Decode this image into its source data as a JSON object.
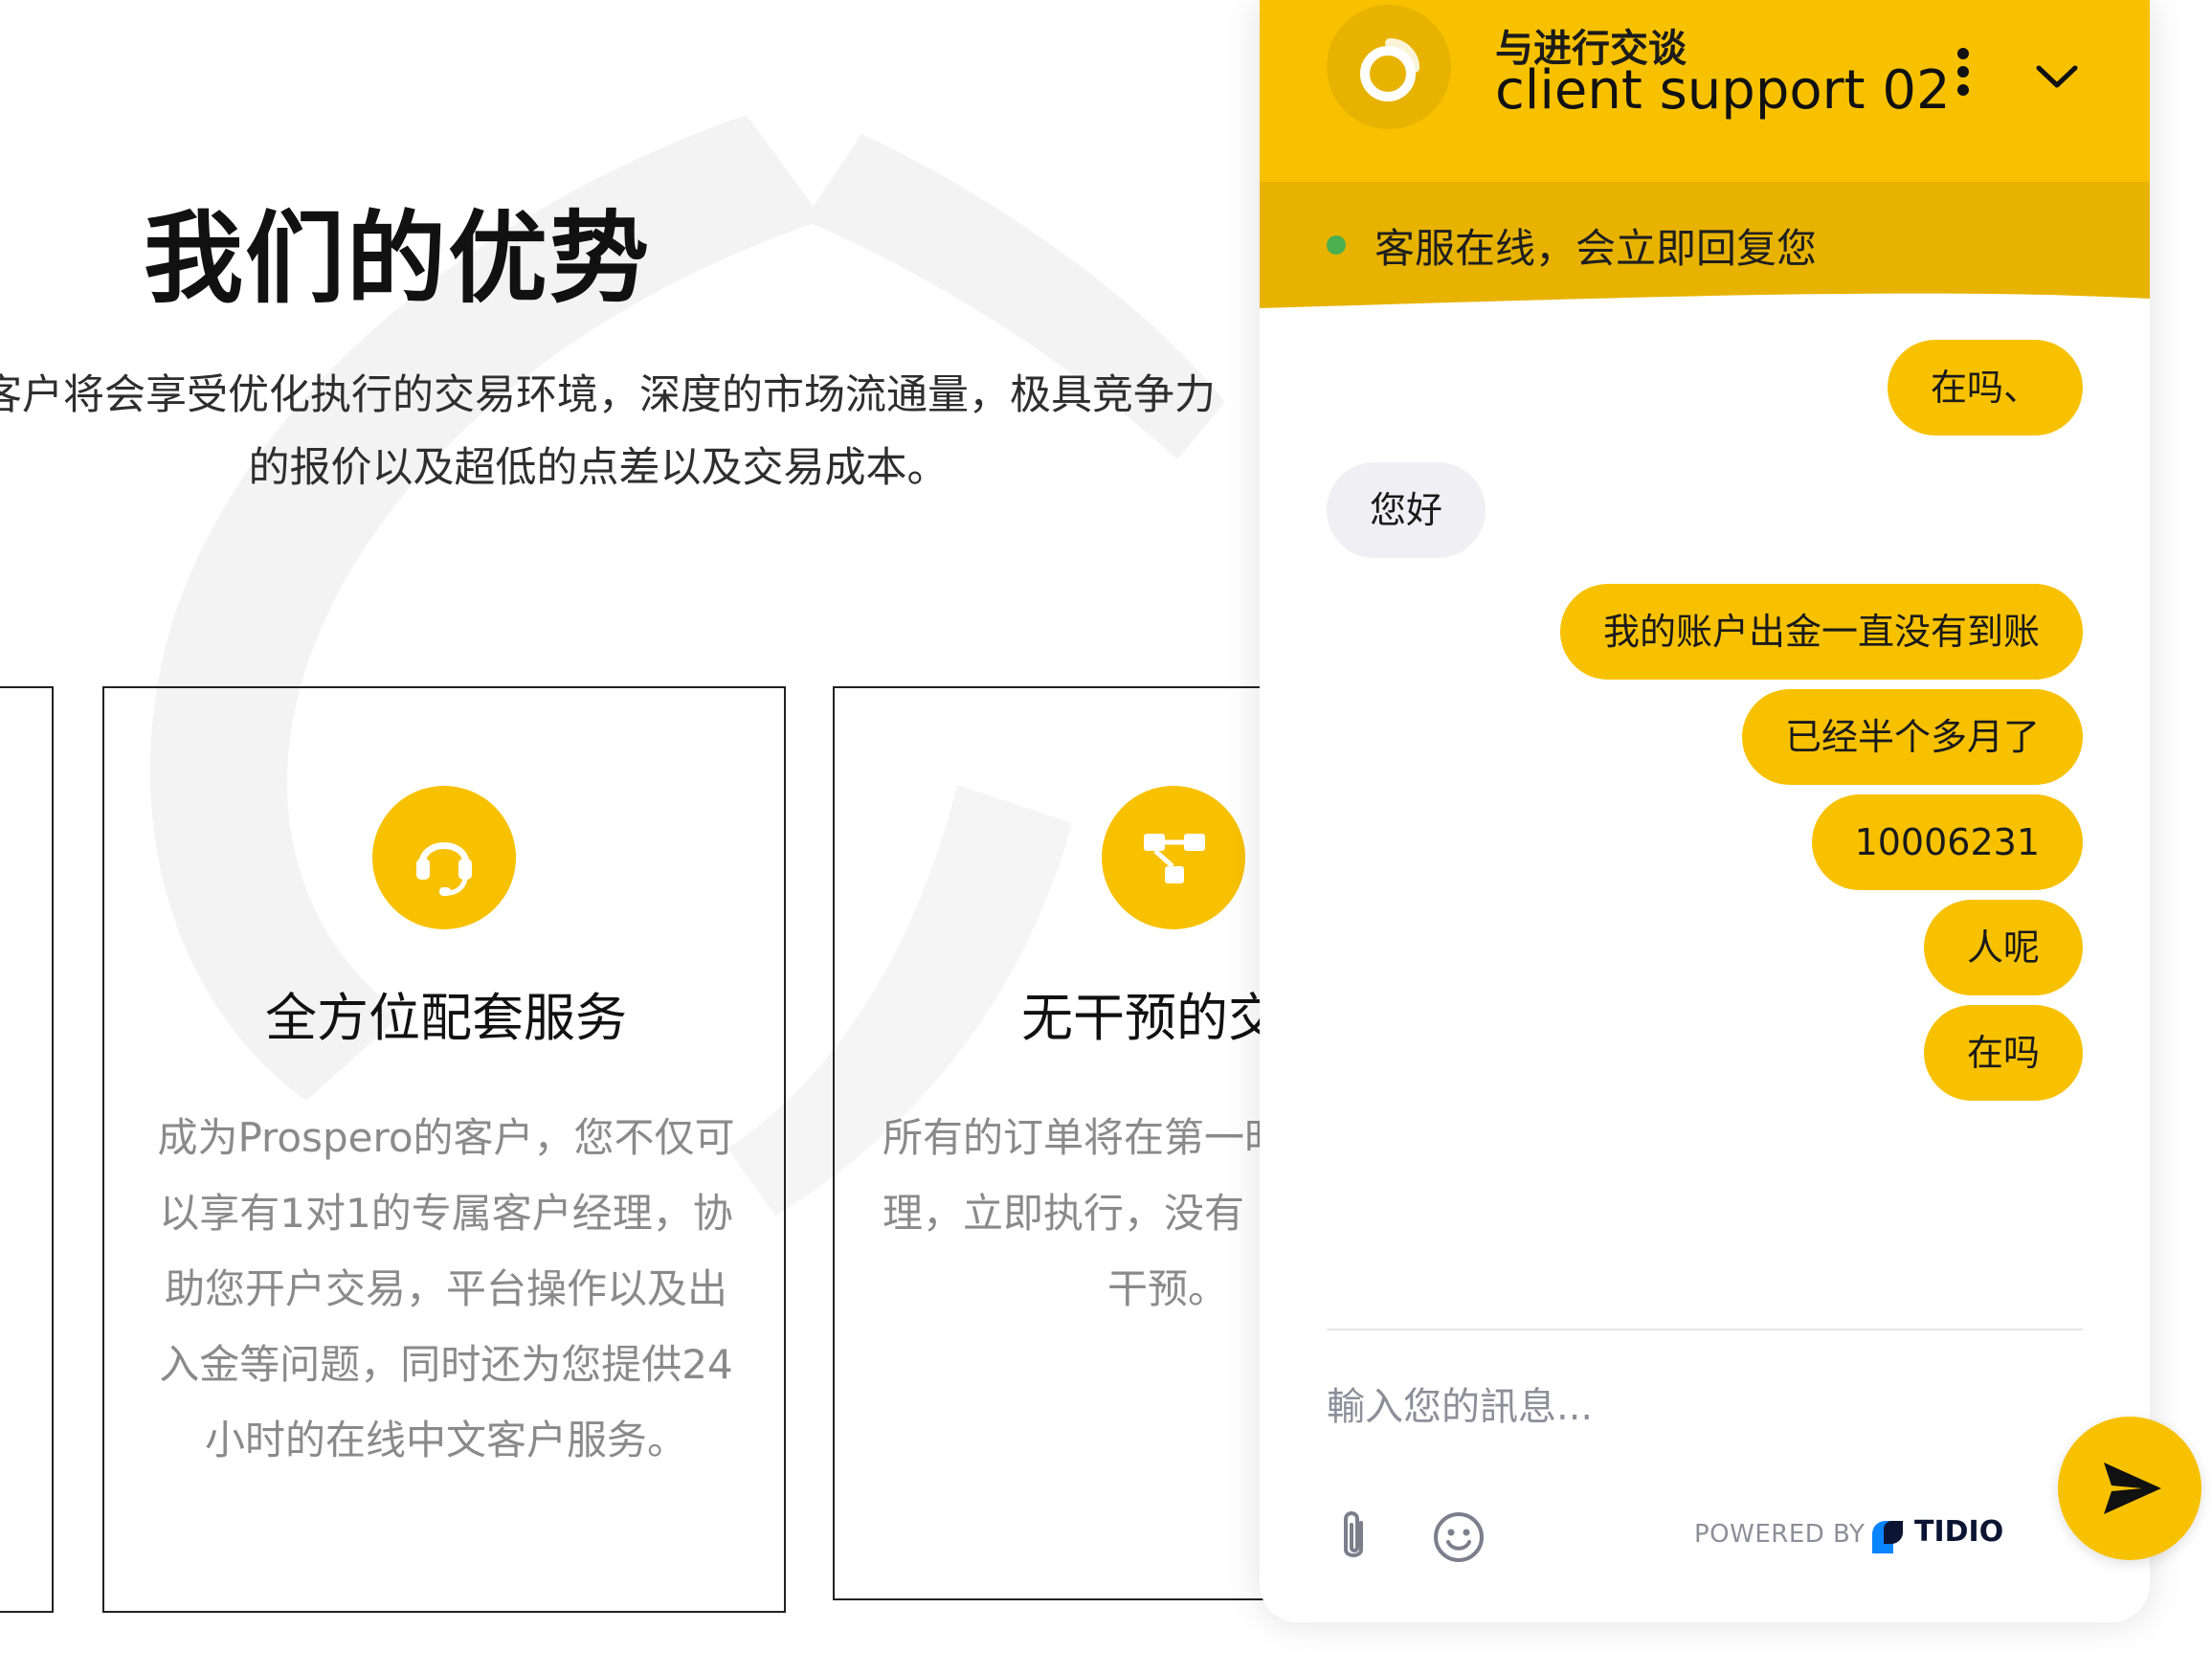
{
  "section": {
    "title": "我们的优势",
    "description_lines": [
      "客户将会享受优化执行的交易环境，深度的市场流通量，极具竞争力",
      "的报价以及超低的点差以及交易成本。"
    ]
  },
  "cards": [
    {
      "icon": "headset-icon",
      "title": "全方位配套服务",
      "text_lines": [
        "成为Prospero的客户，您不仅可",
        "以享有1对1的专属客户经理，协",
        "助您开户交易，平台操作以及出",
        "入金等问题，同时还为您提供24",
        "小时的在线中文客户服务。"
      ]
    },
    {
      "icon": "workflow-icon",
      "title": "无干预的交",
      "text_lines": [
        "所有的订单将在第一时",
        "理，立即执行，没有",
        "干预。"
      ]
    }
  ],
  "chat": {
    "header_subtitle": "与进行交谈",
    "header_title": "client support 02",
    "status_text": "客服在线，会立即回复您",
    "messages": [
      {
        "direction": "out",
        "text": "在吗、"
      },
      {
        "direction": "in",
        "text": "您好"
      },
      {
        "direction": "out",
        "text": "我的账户出金一直没有到账"
      },
      {
        "direction": "out",
        "text": "已经半个多月了"
      },
      {
        "direction": "out",
        "text": "10006231"
      },
      {
        "direction": "out",
        "text": "人呢"
      },
      {
        "direction": "out",
        "text": "在吗"
      }
    ],
    "input_placeholder": "輸入您的訊息...",
    "powered_by": "POWERED BY",
    "brand": "TIDIO"
  },
  "colors": {
    "accent": "#f8c100",
    "accent_dark": "#e7b300",
    "status_online": "#4caf50",
    "bubble_in": "#efeff4"
  },
  "icons": {
    "avatar": "tidio-avatar-icon",
    "more": "more-vertical-icon",
    "collapse": "chevron-down-icon",
    "attach": "paperclip-icon",
    "emoji": "smiley-icon",
    "send": "send-icon"
  }
}
